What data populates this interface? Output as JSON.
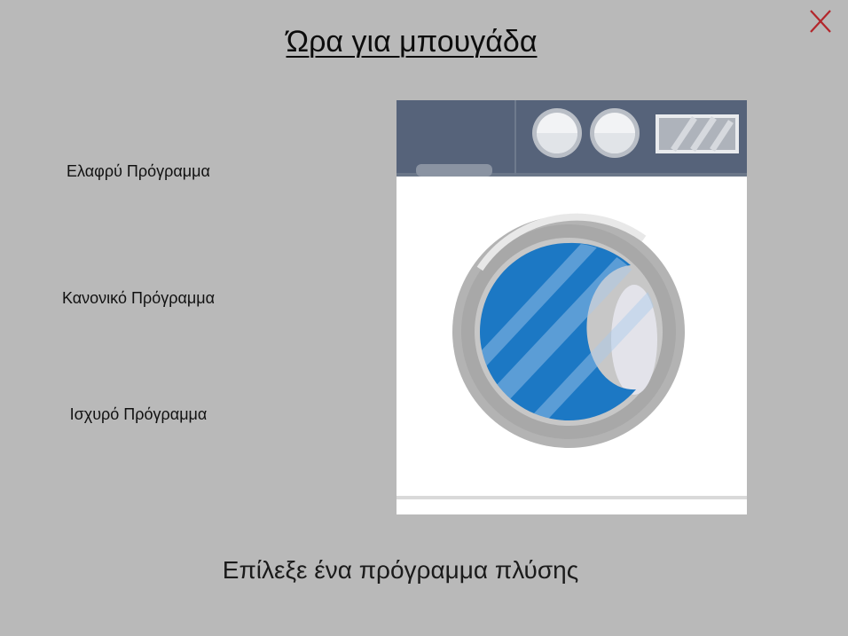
{
  "title": "Ώρα για μπουγάδα",
  "programs": [
    {
      "label": "Ελαφρύ Πρόγραμμα"
    },
    {
      "label": "Κανονικό Πρόγραμμα"
    },
    {
      "label": "Ισχυρό Πρόγραμμα"
    }
  ],
  "instruction": "Επίλεξε ένα πρόγραμμα πλύσης",
  "icons": {
    "close": "close-icon",
    "washer": "washing-machine-illustration"
  },
  "colors": {
    "background": "#b9b9b9",
    "close_icon": "#b3262b",
    "washer_panel": "#56637a",
    "washer_body": "#ffffff",
    "drum_glass": "#1c78c4",
    "door_ring": "#b3b3b3"
  }
}
